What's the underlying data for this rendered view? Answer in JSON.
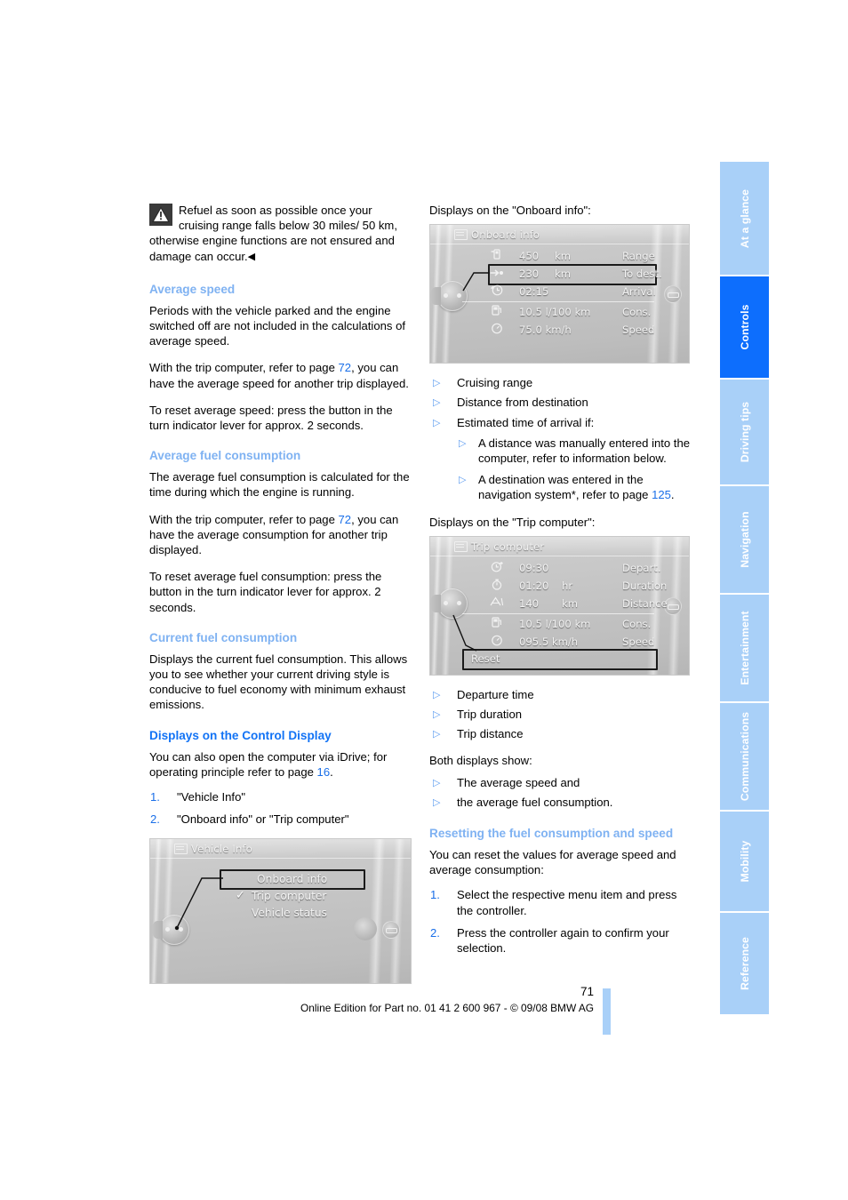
{
  "page": {
    "number": "71",
    "footer": "Online Edition for Part no. 01 41 2 600 967  - © 09/08 BMW AG",
    "accent_light": "#A9D0F8",
    "accent_strong": "#0D6EFD",
    "heading_color": "#7FB2F2",
    "link_color": "#1A6FE8"
  },
  "sidebar": {
    "tabs": [
      {
        "label": "At a glance",
        "active": false
      },
      {
        "label": "Controls",
        "active": true
      },
      {
        "label": "Driving tips",
        "active": false
      },
      {
        "label": "Navigation",
        "active": false
      },
      {
        "label": "Entertainment",
        "active": false
      },
      {
        "label": "Communications",
        "active": false
      },
      {
        "label": "Mobility",
        "active": false
      },
      {
        "label": "Reference",
        "active": false
      }
    ]
  },
  "left_column": {
    "warning": {
      "icon": "warning-triangle-icon",
      "text": "Refuel as soon as possible once your cruising range falls below 30 miles/ 50 km, otherwise engine functions are not ensured and damage can occur.",
      "end_marker": "◀"
    },
    "average_speed": {
      "heading": "Average speed",
      "p1": "Periods with the vehicle parked and the engine switched off are not included in the calculations of average speed.",
      "p2_before": "With the trip computer, refer to page ",
      "p2_link": "72",
      "p2_after": ", you can have the average speed for another trip displayed.",
      "p3": "To reset average speed: press the button in the turn indicator lever for approx. 2 seconds."
    },
    "average_fuel_consumption": {
      "heading": "Average fuel consumption",
      "p1": "The average fuel consumption is calculated for the time during which the engine is running.",
      "p2_before": "With the trip computer, refer to page ",
      "p2_link": "72",
      "p2_after": ", you can have the average consumption for another trip displayed.",
      "p3": "To reset average fuel consumption: press the button in the turn indicator lever for approx. 2 seconds."
    },
    "current_fuel_consumption": {
      "heading": "Current fuel consumption",
      "p1": "Displays the current fuel consumption. This allows you to see whether your current driving style is conducive to fuel economy with minimum exhaust emissions."
    },
    "control_display": {
      "heading": "Displays on the Control Display",
      "p1_before": "You can also open the computer via iDrive; for operating principle refer to page ",
      "p1_link": "16",
      "p1_after": ".",
      "steps": [
        {
          "num": "1.",
          "text": "\"Vehicle Info\""
        },
        {
          "num": "2.",
          "text": "\"Onboard info\" or \"Trip computer\""
        }
      ]
    }
  },
  "vehicle_info_screen": {
    "title": "Vehicle Info",
    "title_icon": "vehicle-icon",
    "items": [
      {
        "label": "Onboard info",
        "selected": true,
        "checked": false
      },
      {
        "label": "Trip computer",
        "selected": false,
        "checked": true
      },
      {
        "label": "Vehicle status",
        "selected": false,
        "checked": false
      }
    ],
    "controller_icon": "idrive-controller-icon"
  },
  "right_column": {
    "onboard_caption": "Displays on the \"Onboard info\":",
    "onboard_bullets": [
      {
        "text": "Cruising range",
        "children": []
      },
      {
        "text": "Distance from destination",
        "children": []
      },
      {
        "text": "Estimated time of arrival if:",
        "children": [
          {
            "text": "A distance was manually entered into the computer, refer to information below."
          },
          {
            "text_before": "A destination was entered in the navigation system*, refer to page ",
            "link": "125",
            "text_after": "."
          }
        ]
      }
    ],
    "trip_caption": "Displays on the \"Trip computer\":",
    "trip_bullets": [
      {
        "text": "Departure time"
      },
      {
        "text": "Trip duration"
      },
      {
        "text": "Trip distance"
      }
    ],
    "both_caption": "Both displays show:",
    "both_bullets": [
      {
        "text": "The average speed and"
      },
      {
        "text": "the average fuel consumption."
      }
    ],
    "resetting": {
      "heading": "Resetting the fuel consumption and speed",
      "p1": "You can reset the values for average speed and average consumption:",
      "steps": [
        {
          "num": "1.",
          "text": "Select the respective menu item and press the controller."
        },
        {
          "num": "2.",
          "text": "Press the controller again to confirm your selection."
        }
      ]
    }
  },
  "onboard_info_screen": {
    "title": "Onboard info",
    "title_icon": "screen-icon",
    "rows": [
      {
        "icon": "fuel-pump-range-icon",
        "value": "450",
        "unit": "km",
        "label": "Range",
        "selected": false
      },
      {
        "icon": "arrow-to-destination-icon",
        "value": "230",
        "unit": "km",
        "label": "To dest.",
        "selected": true
      },
      {
        "icon": "clock-arrival-icon",
        "value": "02:15",
        "unit": "",
        "label": "Arrival",
        "selected": false
      },
      {
        "icon": "fuel-consumption-icon",
        "value": "10.5 l/100 km",
        "unit": "",
        "label": "Cons.",
        "selected": false
      },
      {
        "icon": "speedometer-icon",
        "value": "75.0 km/h",
        "unit": "",
        "label": "Speed",
        "selected": false
      }
    ],
    "controller_icon": "idrive-controller-icon"
  },
  "trip_computer_screen": {
    "title": "Trip computer",
    "title_icon": "screen-icon",
    "rows": [
      {
        "icon": "departure-clock-icon",
        "value": "09:30",
        "unit": "",
        "label": "Depart.",
        "selected": false
      },
      {
        "icon": "stopwatch-icon",
        "value": "01:20",
        "unit": "hr",
        "label": "Duration",
        "selected": false
      },
      {
        "icon": "distance-car-icon",
        "value": "140",
        "unit": "km",
        "label": "Distance",
        "selected": false
      },
      {
        "icon": "fuel-consumption-icon",
        "value": "10.5 l/100 km",
        "unit": "",
        "label": "Cons.",
        "selected": false
      },
      {
        "icon": "speedometer-icon",
        "value": "095.5 km/h",
        "unit": "",
        "label": "Speed",
        "selected": false
      }
    ],
    "reset_button": "Reset",
    "controller_icon": "idrive-controller-icon"
  }
}
